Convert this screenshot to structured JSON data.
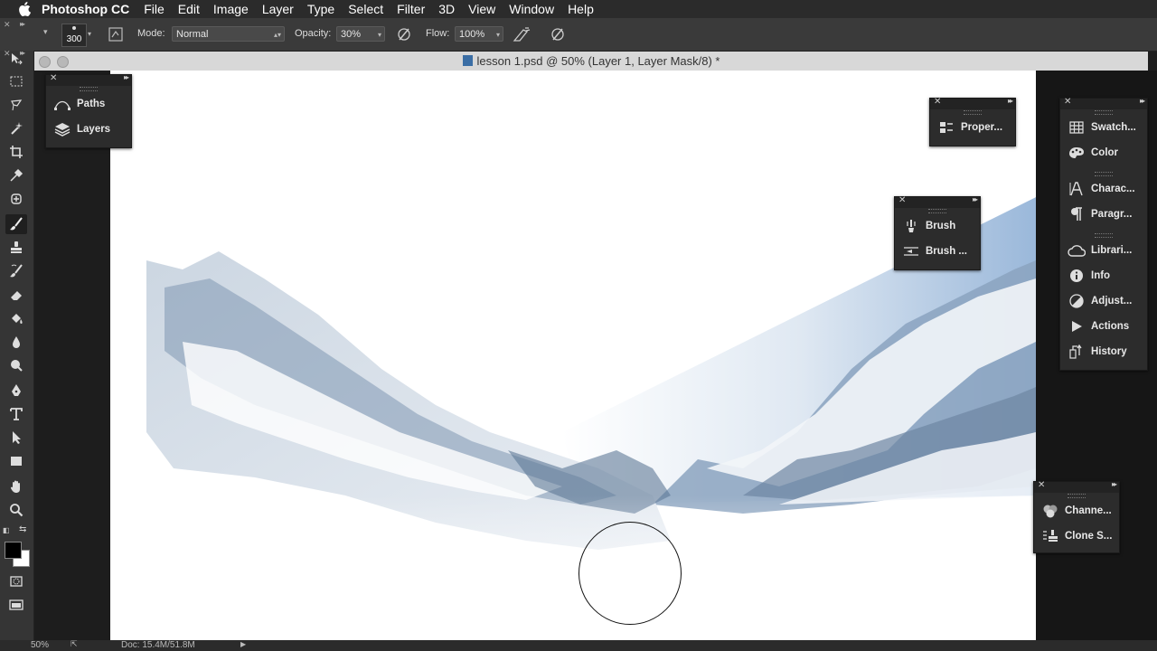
{
  "menubar": {
    "app_name": "Photoshop CC",
    "items": [
      "File",
      "Edit",
      "Image",
      "Layer",
      "Type",
      "Select",
      "Filter",
      "3D",
      "View",
      "Window",
      "Help"
    ]
  },
  "options": {
    "brush_size": "300",
    "mode_label": "Mode:",
    "mode_value": "Normal",
    "opacity_label": "Opacity:",
    "opacity_value": "30%",
    "flow_label": "Flow:",
    "flow_value": "100%"
  },
  "document": {
    "title": "lesson 1.psd @ 50% (Layer 1, Layer Mask/8) *"
  },
  "panels": {
    "left_dock": [
      "Paths",
      "Layers"
    ],
    "properties": [
      "Proper..."
    ],
    "brush": [
      "Brush",
      "Brush ..."
    ],
    "right_dock_1": [
      "Swatch...",
      "Color"
    ],
    "right_dock_2": [
      "Charac...",
      "Paragr..."
    ],
    "right_dock_3": [
      "Librari...",
      "Info",
      "Adjust...",
      "Actions",
      "History"
    ],
    "bottom_right": [
      "Channe...",
      "Clone S..."
    ]
  },
  "status": {
    "zoom": "50%",
    "doc_size": "Doc: 15.4M/51.8M"
  },
  "colors": {
    "foreground": "#000000",
    "background": "#ffffff",
    "sky": "#9ab7d8"
  }
}
